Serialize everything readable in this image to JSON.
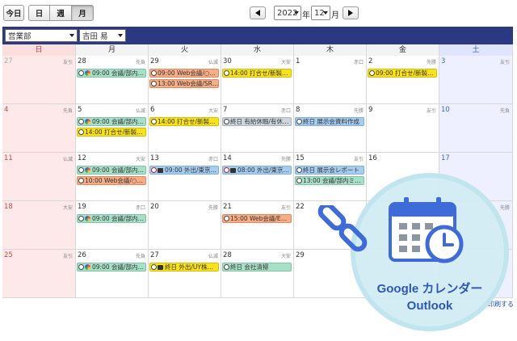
{
  "toolbar": {
    "today": "今日",
    "view_day": "日",
    "view_week": "週",
    "view_month": "月",
    "year": "2022",
    "year_unit": "年",
    "month": "12",
    "month_unit": "月"
  },
  "filters": {
    "department": "営業部",
    "person": "吉田 易"
  },
  "weekdays": [
    "日",
    "月",
    "火",
    "水",
    "木",
    "金",
    "土"
  ],
  "weeks": [
    [
      {
        "d": "27",
        "r": "友引",
        "other": true,
        "events": []
      },
      {
        "d": "28",
        "r": "先負",
        "events": [
          {
            "c": "green",
            "icon": "multi",
            "t": "09:00 会議/部内…"
          }
        ]
      },
      {
        "d": "29",
        "r": "仏滅",
        "events": [
          {
            "c": "orange",
            "icon": "clock",
            "t": "09:00 Web会議/○…"
          },
          {
            "c": "orange",
            "icon": "clock",
            "t": "13:00 Web会議/SR…"
          }
        ]
      },
      {
        "d": "30",
        "r": "大安",
        "events": [
          {
            "c": "yellow",
            "icon": "clock",
            "t": "14:00 打合せ/新製…"
          }
        ]
      },
      {
        "d": "1",
        "r": "赤口",
        "events": []
      },
      {
        "d": "2",
        "r": "先勝",
        "events": [
          {
            "c": "yellow",
            "icon": "clock",
            "t": "09:00 打合せ/新製…"
          }
        ]
      },
      {
        "d": "3",
        "r": "友引",
        "events": []
      }
    ],
    [
      {
        "d": "4",
        "r": "先負",
        "events": []
      },
      {
        "d": "5",
        "r": "仏滅",
        "events": [
          {
            "c": "green",
            "icon": "multi",
            "t": "09:00 会議/部内…"
          },
          {
            "c": "yellow",
            "icon": "clock",
            "t": "14:00 打合せ/新製…"
          }
        ]
      },
      {
        "d": "6",
        "r": "大安",
        "events": [
          {
            "c": "yellow",
            "icon": "clock",
            "t": "14:00 打合せ/新製…"
          }
        ]
      },
      {
        "d": "7",
        "r": "赤口",
        "events": [
          {
            "c": "gray",
            "icon": "clock",
            "t": "終日 有給休暇/有休…"
          }
        ]
      },
      {
        "d": "8",
        "r": "先勝",
        "events": [
          {
            "c": "blue",
            "icon": "clock",
            "t": "終日 展示会資料作成"
          }
        ]
      },
      {
        "d": "9",
        "r": "友引",
        "events": []
      },
      {
        "d": "10",
        "r": "先負",
        "events": []
      }
    ],
    [
      {
        "d": "11",
        "r": "仏滅",
        "events": []
      },
      {
        "d": "12",
        "r": "大安",
        "events": [
          {
            "c": "green",
            "icon": "multi",
            "t": "09:00 会議/部内…"
          },
          {
            "c": "orange",
            "icon": "clock",
            "t": "10:00 Web会議/○…"
          }
        ]
      },
      {
        "d": "13",
        "r": "赤口",
        "events": [
          {
            "c": "blue",
            "icon": "red-bag",
            "t": "09:00 外出/東京…"
          }
        ]
      },
      {
        "d": "14",
        "r": "先勝",
        "events": [
          {
            "c": "blue",
            "icon": "red-bag",
            "t": "08:00 外出/東京…"
          }
        ]
      },
      {
        "d": "15",
        "r": "友引",
        "events": [
          {
            "c": "blue",
            "icon": "clock",
            "t": "終日 展示会レポート"
          },
          {
            "c": "green",
            "icon": "clock",
            "t": "13:00 会議/部内ミ…"
          }
        ]
      },
      {
        "d": "16",
        "r": "",
        "events": []
      },
      {
        "d": "17",
        "r": "",
        "events": []
      }
    ],
    [
      {
        "d": "18",
        "r": "大安",
        "events": []
      },
      {
        "d": "19",
        "r": "赤口",
        "events": [
          {
            "c": "green",
            "icon": "multi",
            "t": "09:00 会議/部内…"
          }
        ]
      },
      {
        "d": "20",
        "r": "先勝",
        "events": []
      },
      {
        "d": "21",
        "r": "友引",
        "events": [
          {
            "c": "orange",
            "icon": "clock",
            "t": "15:00 Web会議/E…"
          }
        ]
      },
      {
        "d": "22",
        "r": "",
        "events": []
      },
      {
        "d": "",
        "r": "",
        "events": []
      },
      {
        "d": "",
        "r": "先勝",
        "events": []
      }
    ],
    [
      {
        "d": "25",
        "r": "友引",
        "events": []
      },
      {
        "d": "26",
        "r": "先負",
        "events": [
          {
            "c": "green",
            "icon": "multi",
            "t": "09:00 会議/部内…"
          }
        ]
      },
      {
        "d": "27",
        "r": "仏滅",
        "events": [
          {
            "c": "yellow",
            "icon": "bag",
            "t": "終日 外出/UY株…"
          }
        ]
      },
      {
        "d": "28",
        "r": "大安",
        "events": [
          {
            "c": "green",
            "icon": "clock",
            "t": "終日 会社清掃"
          }
        ]
      },
      {
        "d": "29",
        "r": "",
        "events": []
      },
      {
        "d": "",
        "r": "",
        "events": []
      },
      {
        "d": "",
        "r": "",
        "events": []
      }
    ]
  ],
  "print_link": "印刷する",
  "overlay": {
    "line1": "Google カレンダー",
    "line2": "Outlook"
  },
  "colors": {
    "header_bar": "#2b3a80",
    "accent": "#2c57b8"
  }
}
